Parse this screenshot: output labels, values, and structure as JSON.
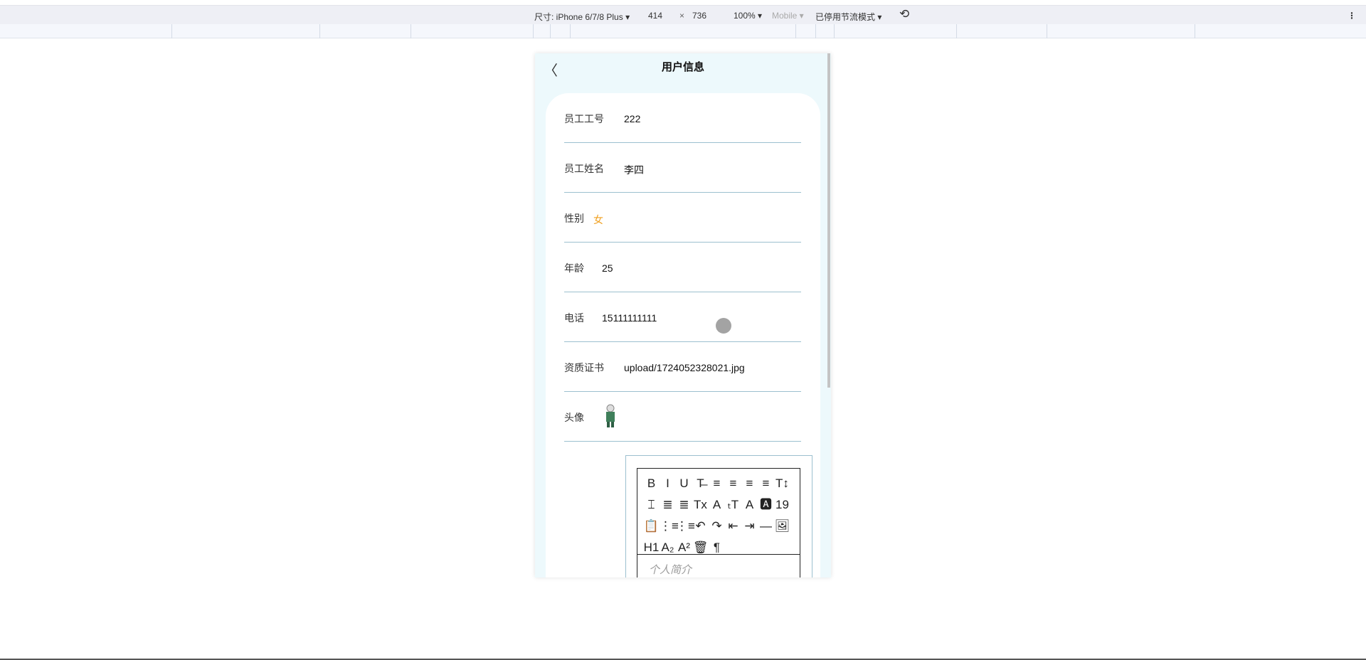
{
  "devtools": {
    "size_label": "尺寸: iPhone 6/7/8 Plus ▾",
    "width": "414",
    "times": "×",
    "height": "736",
    "zoom": "100% ▾",
    "mobile": "Mobile ▾",
    "throttle": "已停用节流模式 ▾",
    "more": "⋮"
  },
  "header": {
    "back": "〈",
    "title": "用户信息"
  },
  "fields": [
    {
      "label": "员工工号",
      "value": "222"
    },
    {
      "label": "员工姓名",
      "value": "李四"
    },
    {
      "label": "性别",
      "value": "女"
    },
    {
      "label": "年龄",
      "value": "25"
    },
    {
      "label": "电话",
      "value": "15111111111"
    },
    {
      "label": "资质证书",
      "value": "upload/1724052328021.jpg"
    },
    {
      "label": "头像",
      "value": ""
    }
  ],
  "editor": {
    "tools": [
      "B",
      "I",
      "U",
      "T̶",
      "≡",
      "≡",
      "≡",
      "≡",
      "T↕",
      "⌶",
      "≣",
      "≣",
      "Tx",
      "A",
      "ₜT",
      "A",
      "🅰",
      "19",
      "📋",
      "⋮≡",
      "⋮≡",
      "↶",
      "↷",
      "⇤",
      "⇥",
      "—",
      "🖼",
      "H1",
      "A₂",
      "A²",
      "🗑",
      "¶"
    ],
    "placeholder": "个人简介"
  },
  "colors": {
    "accent": "#f0a020",
    "frame_bg": "#edf9fc",
    "divider": "#9cc0cf"
  }
}
